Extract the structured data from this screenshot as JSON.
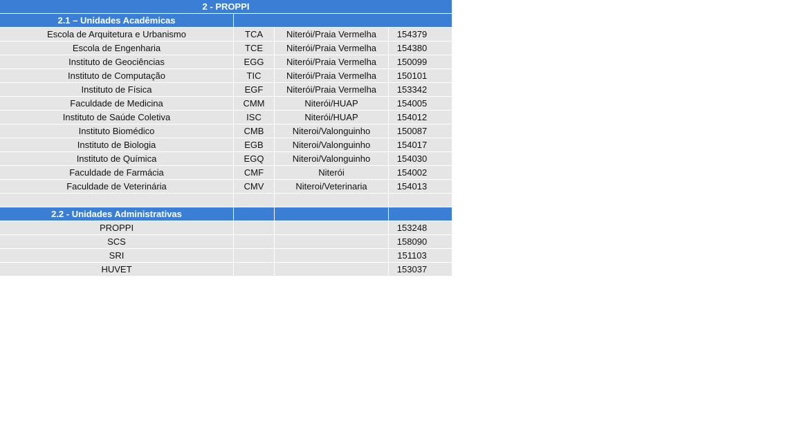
{
  "title": "2 - PROPPI",
  "academic": {
    "heading": "2.1 – Unidades Acadêmicas",
    "rows": [
      {
        "name": "Escola de Arquitetura e Urbanismo",
        "code": "TCA",
        "location": "Niterói/Praia Vermelha",
        "number": "154379"
      },
      {
        "name": "Escola de Engenharia",
        "code": "TCE",
        "location": "Niterói/Praia Vermelha",
        "number": "154380"
      },
      {
        "name": "Instituto de Geociências",
        "code": "EGG",
        "location": "Niterói/Praia Vermelha",
        "number": "150099"
      },
      {
        "name": "Instituto de Computação",
        "code": "TIC",
        "location": "Niterói/Praia Vermelha",
        "number": "150101"
      },
      {
        "name": "Instituto de Física",
        "code": "EGF",
        "location": "Niterói/Praia Vermelha",
        "number": "153342"
      },
      {
        "name": "Faculdade de Medicina",
        "code": "CMM",
        "location": "Niterói/HUAP",
        "number": "154005"
      },
      {
        "name": "Instituto de Saúde Coletiva",
        "code": "ISC",
        "location": "Niterói/HUAP",
        "number": "154012"
      },
      {
        "name": "Instituto Biomédico",
        "code": "CMB",
        "location": "Niteroi/Valonguinho",
        "number": "150087"
      },
      {
        "name": "Instituto de Biologia",
        "code": "EGB",
        "location": "Niteroi/Valonguinho",
        "number": "154017"
      },
      {
        "name": "Instituto de Química",
        "code": "EGQ",
        "location": "Niteroi/Valonguinho",
        "number": "154030"
      },
      {
        "name": "Faculdade de Farmácia",
        "code": "CMF",
        "location": "Niterói",
        "number": "154002"
      },
      {
        "name": "Faculdade de Veterinária",
        "code": "CMV",
        "location": "Niteroi/Veterinaria",
        "number": "154013"
      }
    ]
  },
  "administrative": {
    "heading": "2.2 - Unidades Administrativas",
    "rows": [
      {
        "name": "PROPPI",
        "number": "153248"
      },
      {
        "name": "SCS",
        "number": "158090"
      },
      {
        "name": "SRI",
        "number": "151103"
      },
      {
        "name": "HUVET",
        "number": "153037"
      }
    ]
  },
  "colors": {
    "header_blue": "#3a7fd5",
    "header_text": "#ffffff",
    "cell_gray": "#e5e5e5"
  }
}
